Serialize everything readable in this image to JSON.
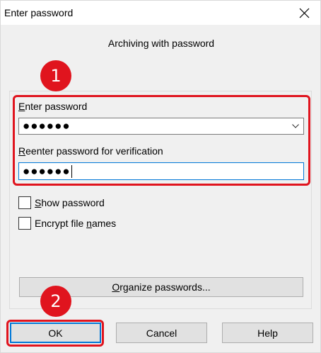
{
  "window": {
    "title": "Enter password",
    "close_icon": "close-icon"
  },
  "header": {
    "subtitle": "Archiving with password"
  },
  "fields": {
    "enter_password_label_first": "E",
    "enter_password_label_rest": "nter password",
    "enter_password_value": "●●●●●●",
    "reenter_label_first": "R",
    "reenter_label_rest": "eenter password for verification",
    "reenter_value": "●●●●●●"
  },
  "options": {
    "show_password_first": "S",
    "show_password_rest": "how password",
    "show_password_checked": false,
    "encrypt_names_pre": "Encrypt file ",
    "encrypt_names_u": "n",
    "encrypt_names_post": "ames",
    "encrypt_names_checked": false
  },
  "organize": {
    "label_first": "O",
    "label_rest": "rganize passwords..."
  },
  "buttons": {
    "ok": "OK",
    "cancel": "Cancel",
    "help": "Help"
  },
  "annotations": {
    "marker1": "1",
    "marker2": "2",
    "highlight_color": "#e0141e"
  }
}
